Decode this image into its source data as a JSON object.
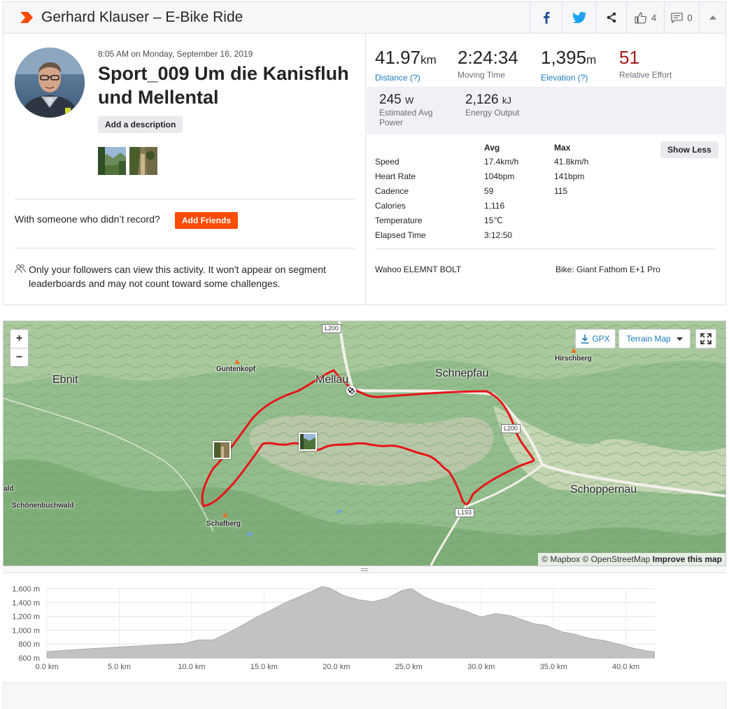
{
  "header": {
    "title": "Gerhard Klauser – E-Bike Ride",
    "kudos_count": "4",
    "comment_count": "0",
    "accent": "#fc4c02"
  },
  "activity": {
    "timestamp": "8:05 AM on Monday, September 16, 2019",
    "name": "Sport_009 Um die Kanisfluh und Mellental",
    "add_description": "Add a description",
    "with_someone": "With someone who didn’t record?",
    "add_friends": "Add Friends",
    "privacy": "Only your followers can view this activity. It won't appear on segment leaderboards and may not count toward some challenges."
  },
  "stats": {
    "distance": {
      "value": "41.97",
      "unit": "km",
      "label": "Distance (?)"
    },
    "moving_time": {
      "value": "2:24:34",
      "label": "Moving Time"
    },
    "elevation": {
      "value": "1,395",
      "unit": "m",
      "label": "Elevation (?)"
    },
    "effort": {
      "value": "51",
      "label": "Relative Effort"
    },
    "power": {
      "value": "245",
      "unit": "W",
      "label": "Estimated Avg Power"
    },
    "energy": {
      "value": "2,126",
      "unit": "kJ",
      "label": "Energy Output"
    }
  },
  "details": {
    "col_avg": "Avg",
    "col_max": "Max",
    "show_less": "Show Less",
    "rows": [
      {
        "label": "Speed",
        "avg": "17.4km/h",
        "max": "41.8km/h"
      },
      {
        "label": "Heart Rate",
        "avg": "104bpm",
        "max": "141bpm"
      },
      {
        "label": "Cadence",
        "avg": "59",
        "max": "115"
      },
      {
        "label": "Calories",
        "avg": "1,116",
        "max": ""
      },
      {
        "label": "Temperature",
        "avg": "15℃",
        "max": ""
      },
      {
        "label": "Elapsed Time",
        "avg": "3:12:50",
        "max": ""
      }
    ],
    "device": "Wahoo ELEMNT BOLT",
    "bike": "Bike: Giant Fathom E+1 Pro"
  },
  "map": {
    "zoom_in": "+",
    "zoom_out": "−",
    "gpx": "GPX",
    "map_type": "Terrain Map",
    "attribution": "© Mapbox © OpenStreetMap",
    "improve": "Improve this map",
    "places": [
      "Ebnit",
      "Mellau",
      "Schnepfau",
      "Schoppernau",
      "Schönenbuchwald",
      "ald"
    ],
    "peaks": [
      "Guntenkopf",
      "Hirschberg",
      "Schafberg"
    ],
    "roads": [
      "L200",
      "L200",
      "L193"
    ],
    "route_color": "#e8141a"
  },
  "elevation_chart": {
    "y_ticks": [
      "1,600 m",
      "1,400 m",
      "1,200 m",
      "1,000 m",
      "800 m",
      "600 m"
    ],
    "x_ticks": [
      "0.0 km",
      "5.0 km",
      "10.0 km",
      "15.0 km",
      "20.0 km",
      "25.0 km",
      "30.0 km",
      "35.0 km",
      "40.0 km"
    ]
  },
  "chart_data": {
    "type": "area",
    "title": "",
    "xlabel": "",
    "ylabel": "",
    "xlim": [
      0,
      42
    ],
    "ylim": [
      600,
      1700
    ],
    "series": [
      {
        "x": [
          0,
          2,
          4,
          6,
          8,
          9.5,
          10.5,
          11.5,
          12.5,
          13.5,
          14.5,
          15.5,
          16.5,
          17.5,
          18.5,
          19,
          19.5,
          20.5,
          21.5,
          22.5,
          23.5,
          24.5,
          25.2,
          26,
          27,
          28,
          29,
          30,
          31,
          32,
          33,
          33.7,
          34.5,
          35.5,
          36.5,
          37.5,
          38.5,
          39.5,
          40.5,
          41.5,
          41.97
        ],
        "y": [
          690,
          720,
          745,
          770,
          790,
          810,
          860,
          860,
          960,
          1070,
          1190,
          1290,
          1400,
          1490,
          1580,
          1630,
          1610,
          1500,
          1440,
          1410,
          1460,
          1570,
          1600,
          1490,
          1400,
          1340,
          1270,
          1190,
          1240,
          1210,
          1140,
          1090,
          1070,
          980,
          940,
          880,
          850,
          800,
          740,
          700,
          690
        ]
      }
    ]
  }
}
